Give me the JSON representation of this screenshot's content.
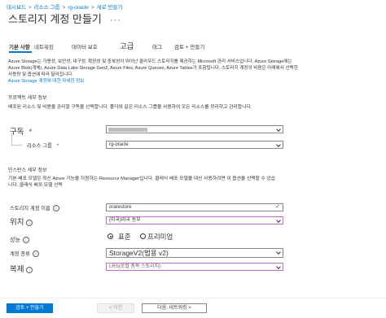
{
  "breadcrumb": [
    "대시보드",
    "리소스 그룹",
    "rg-oracle",
    "새로 만들기"
  ],
  "page_title": "스토리지 계정 만들기",
  "title_ellipsis": "···",
  "tabs": [
    {
      "label": "기본 사항",
      "active": true
    },
    {
      "label": "네트워킹"
    },
    {
      "label": "데이터 보호"
    },
    {
      "label": "고급"
    },
    {
      "label": "태그"
    },
    {
      "label": "검토 + 만들기"
    }
  ],
  "intro": {
    "text": "Azure Storage는 가용성, 보안성, 내구성, 확장성 및 중복성이 뛰어난 클라우드 스토리지를 제공하는 Microsoft 관리 서비스입니다. Azure Storage에는 Azure Blob(개체), Azure Data Lake Storage Gen2, Azure Files, Azure Queues, Azure Tables가 포함됩니다. 스토리지 계정의 비용은 아래에서 선택한 사용량 및 옵션에 따라 달라집니다.",
    "link": "Azure Storage 계정에 대한 자세한 정보"
  },
  "project": {
    "heading": "프로젝트 세부 정보",
    "desc": "배포된 리소스 및 비용을 관리할 구독을 선택합니다. 폴더와 같은 리소스 그룹을 사용하여 모든 리소스를 정리하고 관리합니다.",
    "subscription_label": "구독",
    "subscription_value": "",
    "resource_group_label": "리소스 그룹",
    "resource_group_value": "rg-oracle"
  },
  "instance": {
    "heading": "인스턴스 세부 정보",
    "desc": "기본 배포 모델은 최신 Azure 기능을 지원하는 Resource Manager입니다. 클래식 배포 모델을 대신 사용하려면 이 옵션을 선택할 수 있습니다. 클래식 배포 모델 선택",
    "name_label": "스토리지 계정 이름",
    "name_value": "orarestore",
    "location_label": "위치",
    "location_value": "(미국)미국 동부",
    "performance_label": "성능",
    "performance_options": [
      "표준",
      "프리미엄"
    ],
    "account_kind_label": "계정 종류",
    "account_kind_value": "StorageV2(범용 v2)",
    "replication_label": "복제",
    "replication_value": "LRS(로컬 중복 스토리지)"
  },
  "footer": {
    "create": "검토 + 만들기",
    "previous": "< 이전",
    "next": "다음: 네트워킹 >"
  },
  "colors": {
    "accent": "#0078d4",
    "required": "#a4262c",
    "valid": "#107c10",
    "focus": "#c76fd6"
  }
}
